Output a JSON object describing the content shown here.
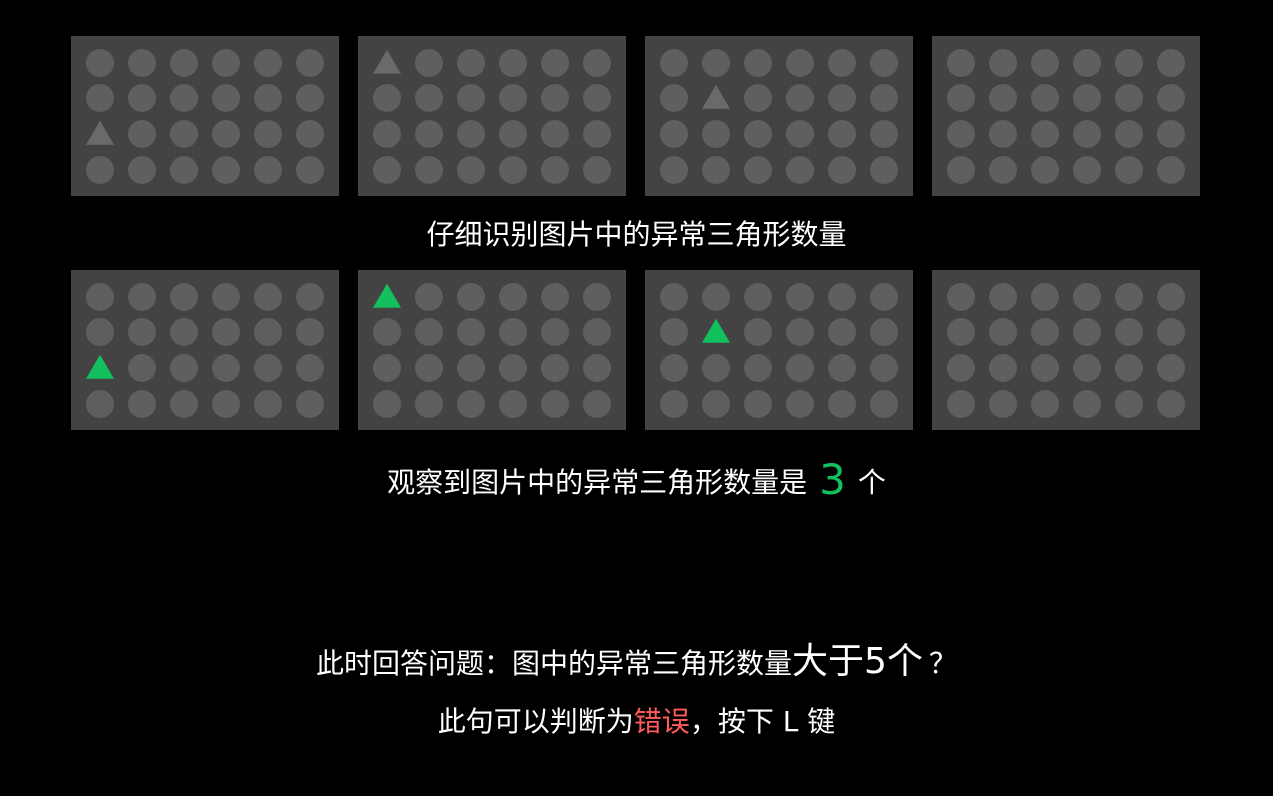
{
  "instruction_text": "仔细识别图片中的异常三角形数量",
  "observation": {
    "prefix": "观察到图片中的异常三角形数量是",
    "count": "3",
    "suffix": "个"
  },
  "question": {
    "prefix": "此时回答问题：图中的异常三角形数量",
    "emphasis": "大于5个",
    "mark": "？"
  },
  "hint": {
    "prefix": "此句可以判断为",
    "judgement": "错误",
    "suffix": "，按下 L 键"
  },
  "grid": {
    "rows": 4,
    "cols": 6,
    "circle_color": "#5f5f5f",
    "panel_color": "#434343",
    "highlight_color": "#12c15e",
    "odd_triangle_color": "#6a6a6a"
  },
  "panels_top": [
    {
      "odd_triangle": {
        "row": 2,
        "col": 0
      }
    },
    {
      "odd_triangle": {
        "row": 0,
        "col": 0
      }
    },
    {
      "odd_triangle": {
        "row": 1,
        "col": 1
      }
    },
    {
      "odd_triangle": null
    }
  ],
  "panels_bottom": [
    {
      "odd_triangle": {
        "row": 2,
        "col": 0
      },
      "highlighted": true
    },
    {
      "odd_triangle": {
        "row": 0,
        "col": 0
      },
      "highlighted": true
    },
    {
      "odd_triangle": {
        "row": 1,
        "col": 1
      },
      "highlighted": true
    },
    {
      "odd_triangle": null,
      "highlighted": true
    }
  ]
}
